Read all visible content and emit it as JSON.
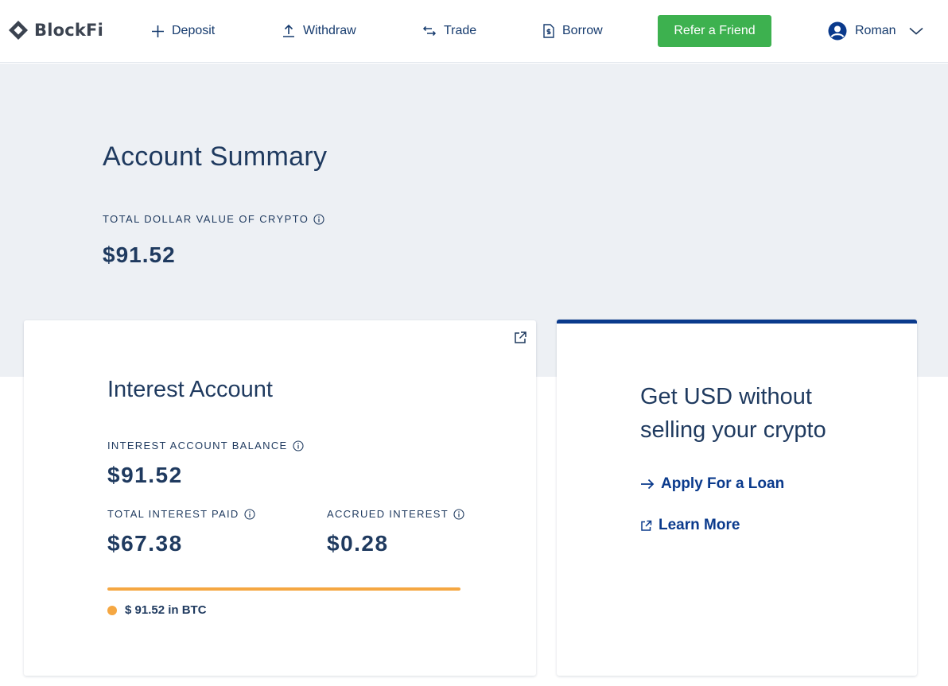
{
  "brand": {
    "name": "BlockFi",
    "logo_icon": "blockfi-diamond-icon"
  },
  "nav": {
    "deposit": {
      "label": "Deposit",
      "icon": "plus-icon"
    },
    "withdraw": {
      "label": "Withdraw",
      "icon": "upload-icon"
    },
    "trade": {
      "label": "Trade",
      "icon": "swap-arrows-icon"
    },
    "borrow": {
      "label": "Borrow",
      "icon": "document-dollar-icon"
    },
    "refer_label": "Refer a Friend",
    "user_name": "Roman"
  },
  "summary": {
    "title": "Account Summary",
    "total_label": "TOTAL DOLLAR VALUE OF CRYPTO",
    "total_value": "$91.52"
  },
  "interest": {
    "title": "Interest Account",
    "balance_label": "INTEREST ACCOUNT BALANCE",
    "balance_value": "$91.52",
    "paid_label": "TOTAL INTEREST PAID",
    "paid_value": "$67.38",
    "accrued_label": "ACCRUED INTEREST",
    "accrued_value": "$0.28",
    "allocation": [
      {
        "label": "$ 91.52 in BTC",
        "fraction": 1.0,
        "color": "#f5a742"
      }
    ]
  },
  "loan": {
    "title": "Get USD without selling your crypto",
    "apply_label": "Apply For a Loan",
    "learn_label": "Learn More"
  },
  "colors": {
    "accent_green": "#3db14f",
    "navy": "#0a3a8c",
    "text": "#1f3a5f",
    "btc_orange": "#f5a742",
    "hero_bg": "#edf0f4"
  }
}
